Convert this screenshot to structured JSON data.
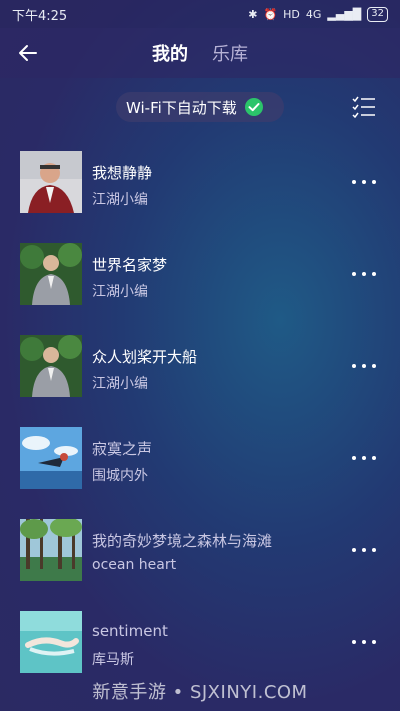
{
  "status_bar": {
    "time": "下午4:25",
    "network": "4G",
    "battery": "32"
  },
  "header": {
    "tabs": [
      {
        "label": "我的"
      },
      {
        "label": "乐库"
      }
    ]
  },
  "wifi_toggle": {
    "label": "Wi-Fi下自动下载",
    "checked": true,
    "check_color": "#2bc46a"
  },
  "songs": [
    {
      "title": "我想静静",
      "artist": "江湖小编",
      "cover": "portrait-man-red-background"
    },
    {
      "title": "世界名家梦",
      "artist": "江湖小编",
      "cover": "portrait-man-trees"
    },
    {
      "title": "众人划桨开大船",
      "artist": "江湖小编",
      "cover": "portrait-man-trees"
    },
    {
      "title": "寂寞之声",
      "artist": "围城内外",
      "cover": "anime-sky"
    },
    {
      "title": "我的奇妙梦境之森林与海滩",
      "artist": "ocean heart",
      "cover": "forest-lake"
    },
    {
      "title": "sentiment",
      "artist": "库马斯",
      "cover": "underwater-swimmer"
    }
  ],
  "watermark": "新意手游 • SJXINYI.COM"
}
